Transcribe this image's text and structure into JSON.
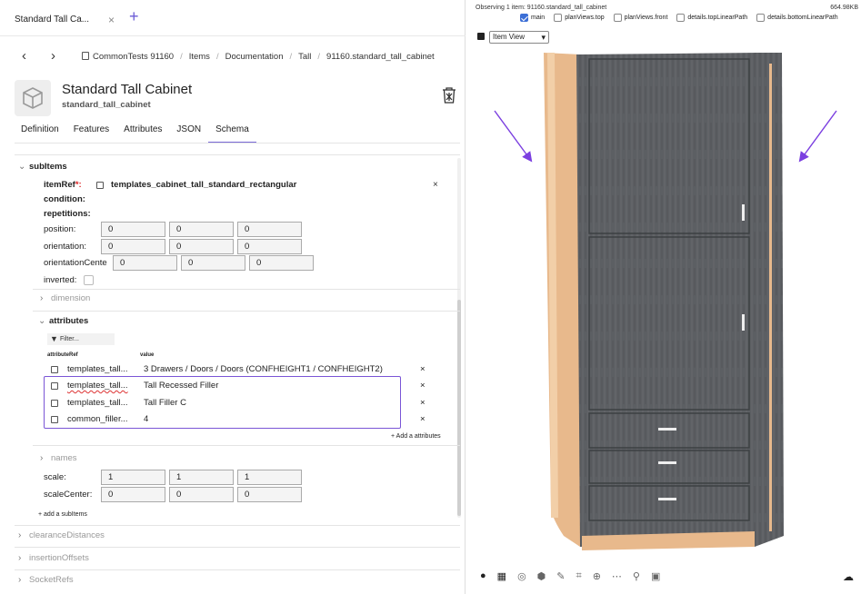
{
  "tab": {
    "title": "Standard Tall Ca...",
    "close": "×",
    "new": "+"
  },
  "nav": {
    "back": "‹",
    "forward": "›"
  },
  "breadcrumbs": [
    "CommonTests 91160",
    "Items",
    "Documentation",
    "Tall",
    "91160.standard_tall_cabinet"
  ],
  "header": {
    "title": "Standard Tall Cabinet",
    "subtitle": "standard_tall_cabinet"
  },
  "tabs": [
    "Definition",
    "Features",
    "Attributes",
    "JSON",
    "Schema"
  ],
  "active_tab": "Schema",
  "schema": {
    "subitems_label": "subItems",
    "itemref_label": "itemRef",
    "itemref_required": "*:",
    "itemref_value": "templates_cabinet_tall_standard_rectangular",
    "condition_label": "condition:",
    "repetitions_label": "repetitions:",
    "position_label": "position:",
    "position": [
      "0",
      "0",
      "0"
    ],
    "orientation_label": "orientation:",
    "orientation": [
      "0",
      "0",
      "0"
    ],
    "orientationcenter_label": "orientationCente",
    "orientationcenter": [
      "0",
      "0",
      "0"
    ],
    "inverted_label": "inverted:",
    "dimension_label": "dimension",
    "attributes_label": "attributes",
    "filter_placeholder": "Filter...",
    "col_ref": "attributeRef",
    "col_value": "value",
    "attribute_rows": [
      {
        "ref": "templates_tall...",
        "value": "3 Drawers / Doors / Doors (CONFHEIGHT1 / CONFHEIGHT2)"
      },
      {
        "ref": "templates_tall...",
        "value": "Tall Recessed Filler"
      },
      {
        "ref": "templates_tall...",
        "value": "Tall Filler C"
      },
      {
        "ref": "common_filler...",
        "value": "4"
      }
    ],
    "add_attribute": "+ Add a attributes",
    "names_label": "names",
    "scale_label": "scale:",
    "scale": [
      "1",
      "1",
      "1"
    ],
    "scalecenter_label": "scaleCenter:",
    "scalecenter": [
      "0",
      "0",
      "0"
    ],
    "add_subitems": "+ add a subItems",
    "clearance_label": "clearanceDistances",
    "insertion_label": "insertionOffsets",
    "more_label": "SocketRefs"
  },
  "viewer": {
    "observing": "Observing 1 item: 91160.standard_tall_cabinet",
    "size": "664.98KB",
    "views": [
      {
        "label": "main",
        "checked": true
      },
      {
        "label": "planViews.top",
        "checked": false
      },
      {
        "label": "planViews.front",
        "checked": false
      },
      {
        "label": "details.topLinearPath",
        "checked": false
      },
      {
        "label": "details.bottomLinearPath",
        "checked": false
      }
    ],
    "view_select": "Item View"
  },
  "colors": {
    "accent": "#7a6ad8",
    "cabinet": "#5c5f63",
    "wood": "#e8b98c",
    "arrow": "#7b3fe0"
  }
}
